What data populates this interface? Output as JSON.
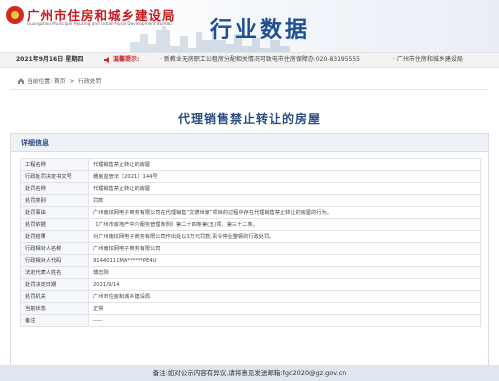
{
  "header": {
    "site_name": "广州市住房和城乡建设局",
    "site_subtitle": "Guangzhou Municipal Housing and Urban-Rural Development Bureau",
    "page_heading": "行业数据"
  },
  "notice": {
    "date": "2021年9月16日 星期四",
    "label": "温馨提示:",
    "text": "· 新教业无房职工公租房分配相关情况可致电市住房保障办:020-83195555",
    "right": "· 广州市住房和城乡建设局"
  },
  "breadcrumb": {
    "prefix": "当前位置:",
    "home": "首页",
    "sep": ">",
    "current": "行政处罚"
  },
  "title": "代理销售禁止转让的房屋",
  "panel": {
    "heading": "详细信息",
    "rows": [
      {
        "key": "工程名称",
        "value": "代理销售禁止转让的房屋"
      },
      {
        "key": "行政处罚决定书文号",
        "value": "穗房监管法〔2021〕144号"
      },
      {
        "key": "处罚名称",
        "value": "代理销售禁止转让的房屋"
      },
      {
        "key": "处罚类别",
        "value": "罚款"
      },
      {
        "key": "处罚事由",
        "value": "广州南炫网电子商务有限公司在代理销售“文德世家”项目的过程中存在代理销售禁止转让的房屋的行为。"
      },
      {
        "key": "处罚依据",
        "value": "《广州市房地产中介服务管理条例》第二十四条第(五)项、第三十二条。"
      },
      {
        "key": "处罚结果",
        "value": "对广州南炫网电子商务有限公司作出处以3万元罚款,责令停业整顿的行政处罚。"
      },
      {
        "key": "行政相对人名称",
        "value": "广州南炫网电子商务有限公司"
      },
      {
        "key": "行政相对人代码",
        "value": "91440111MA******PE4U"
      },
      {
        "key": "法定代表人姓名",
        "value": "傅志刚"
      },
      {
        "key": "处罚决定日期",
        "value": "2021/9/14"
      },
      {
        "key": "处罚机关",
        "value": "广州市住房和城乡建设局"
      },
      {
        "key": "当前状态",
        "value": "正常"
      },
      {
        "key": "备注",
        "value": "-----"
      }
    ]
  },
  "footer": {
    "text": "备注:如对公示内容有异议,请将意见发送邮箱:",
    "email": "fgc2020@gz.gov.cn"
  },
  "colors": {
    "brand_red": "#c8171d",
    "heading_blue": "#1d4f91",
    "title_blue": "#2b4c83",
    "notice_red": "#d0202a",
    "footer_bg": "#dfe6ef"
  }
}
